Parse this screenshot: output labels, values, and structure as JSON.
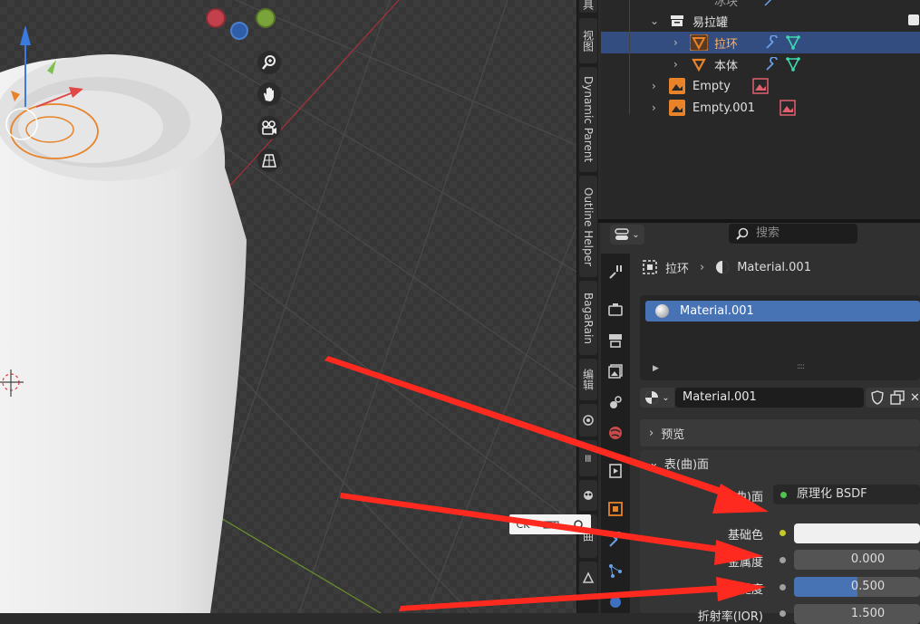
{
  "outliner": {
    "rows": [
      {
        "label": "冰块"
      },
      {
        "label": "易拉罐"
      },
      {
        "label": "拉环"
      },
      {
        "label": "本体"
      },
      {
        "label": "Empty"
      },
      {
        "label": "Empty.001"
      }
    ]
  },
  "n_panel_tabs": [
    "视图",
    "Dynamic Parent",
    "Outline Helper",
    "BagaRain",
    "编辑",
    "曲"
  ],
  "properties": {
    "search_placeholder": "搜索",
    "breadcrumb": {
      "object": "拉环",
      "material": "Material.001"
    },
    "material_slot": "Material.001",
    "material_name": "Material.001",
    "panels": {
      "preview": "预览",
      "surface": "表(曲)面"
    },
    "surface_field_label": "表(曲)面",
    "surface_shader": "原理化 BSDF",
    "rows": [
      {
        "label": "基础色",
        "value": ""
      },
      {
        "label": "金属度",
        "value": "0.000"
      },
      {
        "label": "糙度",
        "value": "0.500",
        "fill": 0.5
      },
      {
        "label": "折射率(IOR)",
        "value": "1.500"
      }
    ]
  },
  "colors": {
    "accent": "#4772b3",
    "selected_row": "#334d80",
    "arrow": "#ff2a1f",
    "object_orange": "#e8832a"
  }
}
